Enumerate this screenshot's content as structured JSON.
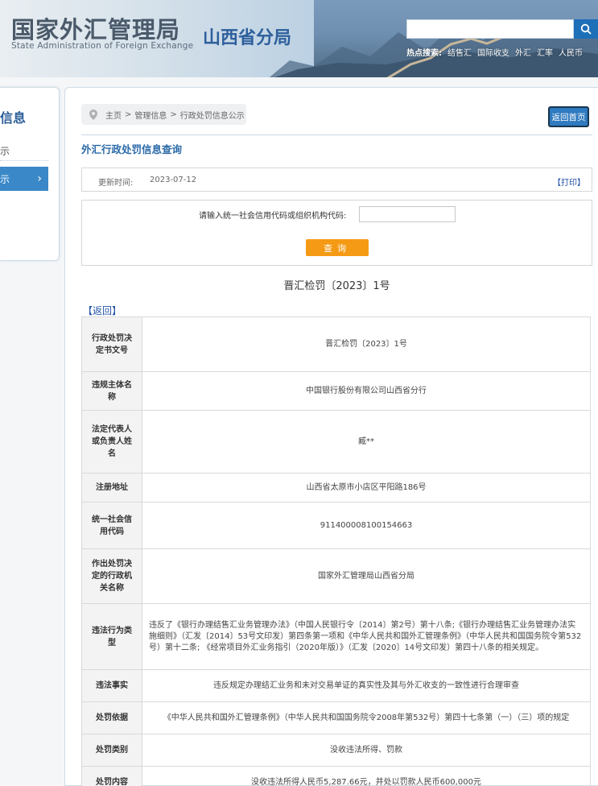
{
  "header": {
    "logo_cn": "国家外汇管理局",
    "logo_en": "State Administration of Foreign Exchange",
    "branch": "山西省分局",
    "search_placeholder": "",
    "search_icon": "search-icon",
    "hot_label": "热点搜索:",
    "hot_links": [
      "结售汇",
      "国际收支",
      "外汇",
      "汇率",
      "人民币"
    ]
  },
  "sidebar": {
    "title": "信息",
    "items": [
      {
        "label": "示",
        "active": false
      },
      {
        "label": "示",
        "active": true,
        "arrow": "›"
      }
    ]
  },
  "breadcrumb": [
    "主页",
    ">",
    "管理信息",
    ">",
    "行政处罚信息公示"
  ],
  "back_home": "返回首页",
  "section_title": "外汇行政处罚信息查询",
  "update": {
    "label": "更新时间:",
    "date": "2023-07-12",
    "print": "【打印】"
  },
  "query": {
    "label": "请输入统一社会信用代码或组织机构代码:",
    "value": "",
    "button": "查询"
  },
  "doc_title": "晋汇检罚〔2023〕1号",
  "return_link": "【返回】",
  "rows": [
    {
      "key": "行政处罚决定书文号",
      "value": "晋汇检罚〔2023〕1号"
    },
    {
      "key": "违规主体名称",
      "value": "中国银行股份有限公司山西省分行"
    },
    {
      "key": "法定代表人或负责人姓名",
      "value": "臧**"
    },
    {
      "key": "注册地址",
      "value": "山西省太原市小店区平阳路186号"
    },
    {
      "key": "统一社会信用代码",
      "value": "911400008100154663"
    },
    {
      "key": "作出处罚决定的行政机关名称",
      "value": "国家外汇管理局山西省分局"
    },
    {
      "key": "违法行为类型",
      "value": "违反了《银行办理结售汇业务管理办法》（中国人民银行令〔2014〕第2号）第十八条;《银行办理结售汇业务管理办法实施细则》（汇发〔2014〕53号文印发）第四条第一项和《中华人民共和国外汇管理条例》（中华人民共和国国务院令第532号）第十二条; 《经常项目外汇业务指引（2020年版）》（汇发〔2020〕14号文印发）第四十八条的相关规定。"
    },
    {
      "key": "违法事实",
      "value": "违反规定办理结汇业务和未对交易单证的真实性及其与外汇收支的一致性进行合理审查"
    },
    {
      "key": "处罚依据",
      "value": "《中华人民共和国外汇管理条例》（中华人民共和国国务院令2008年第532号）第四十七条第（一）（三）项的规定"
    },
    {
      "key": "处罚类别",
      "value": "没收违法所得、罚款"
    },
    {
      "key": "处罚内容",
      "value": "没收违法所得人民币5,287.66元，并处以罚款人民币600,000元"
    }
  ]
}
